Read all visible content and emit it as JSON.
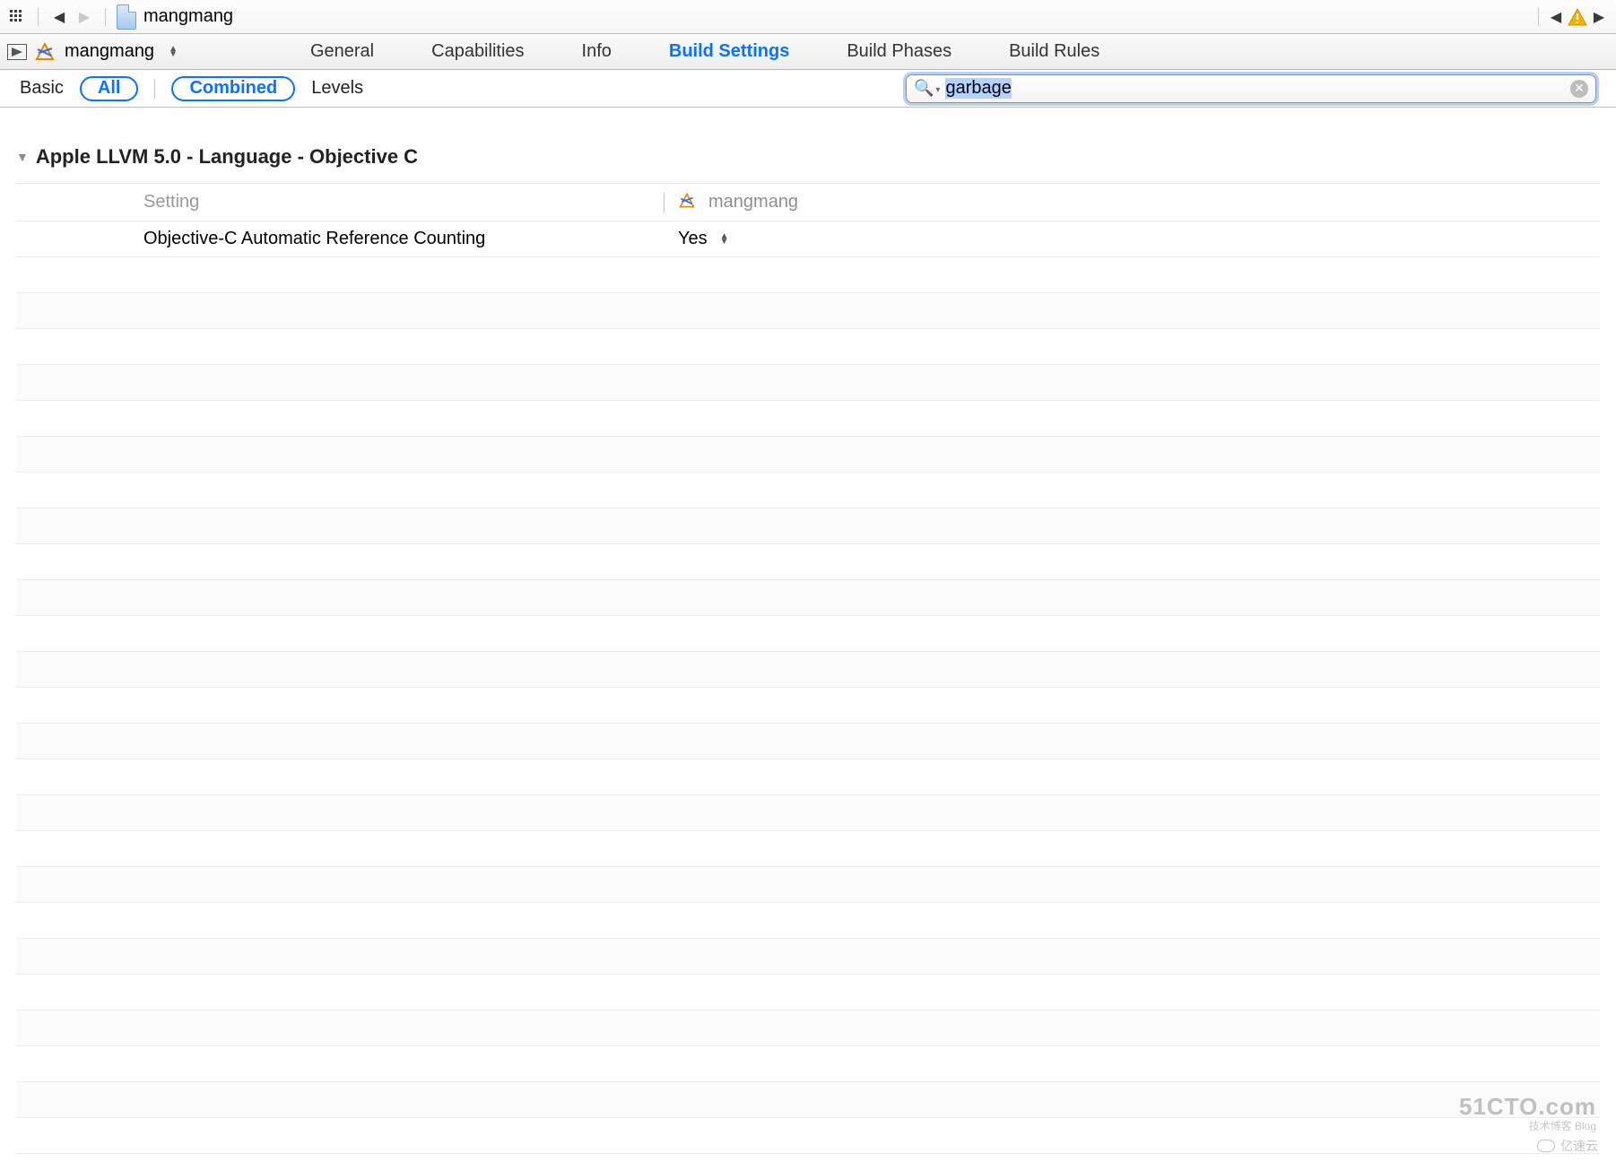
{
  "toolbar": {
    "breadcrumb_file": "mangmang"
  },
  "target": {
    "name": "mangmang"
  },
  "tabs": [
    {
      "id": "general",
      "label": "General",
      "active": false
    },
    {
      "id": "capabilities",
      "label": "Capabilities",
      "active": false
    },
    {
      "id": "info",
      "label": "Info",
      "active": false
    },
    {
      "id": "build-settings",
      "label": "Build Settings",
      "active": true
    },
    {
      "id": "build-phases",
      "label": "Build Phases",
      "active": false
    },
    {
      "id": "build-rules",
      "label": "Build Rules",
      "active": false
    }
  ],
  "filter": {
    "basic": "Basic",
    "all": "All",
    "combined": "Combined",
    "levels": "Levels",
    "search_value": "garbage"
  },
  "section": {
    "title": "Apple LLVM 5.0 - Language - Objective C",
    "col_setting": "Setting",
    "col_target": "mangmang",
    "rows": [
      {
        "setting": "Objective-C Automatic Reference Counting",
        "value": "Yes"
      }
    ]
  },
  "watermarks": {
    "w1": "51CTO.com",
    "w1s": "技术博客  Blog",
    "w2": "亿速云"
  }
}
